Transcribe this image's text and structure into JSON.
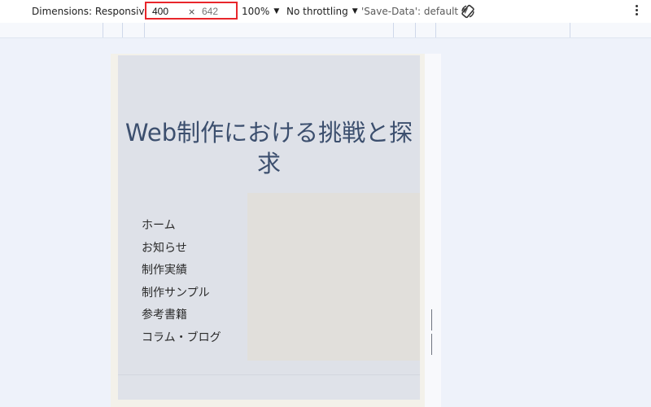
{
  "toolbar": {
    "dimensions_label": "Dimensions: Responsive",
    "width_value": "400",
    "times_symbol": "×",
    "height_placeholder": "642",
    "zoom_label": "100%",
    "throttling_label": "No throttling",
    "save_data_label": "'Save-Data': default",
    "rotate_icon": "rotate-icon",
    "more_icon": "more-vertical-icon"
  },
  "page": {
    "title": "Web制作における挑戦と探求",
    "nav_items": [
      "ホーム",
      "お知らせ",
      "制作実績",
      "制作サンプル",
      "参考書籍",
      "コラム・ブログ"
    ]
  },
  "colors": {
    "highlight_border": "#e8262b",
    "title_color": "#3c4f6e",
    "page_bg": "#dee1e8",
    "hero_block": "#e1dfdb"
  }
}
